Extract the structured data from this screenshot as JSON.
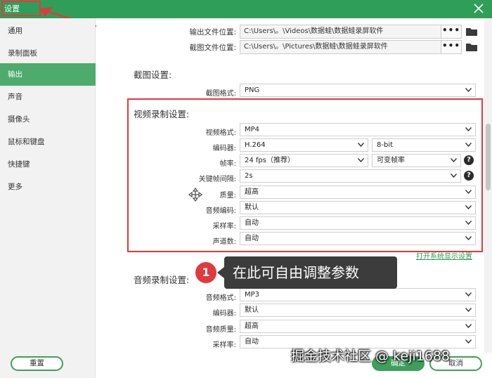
{
  "window": {
    "title": "设置"
  },
  "sidebar": {
    "items": [
      {
        "label": "通用"
      },
      {
        "label": "录制面板"
      },
      {
        "label": "输出"
      },
      {
        "label": "声音"
      },
      {
        "label": "摄像头"
      },
      {
        "label": "鼠标和键盘"
      },
      {
        "label": "快捷键"
      },
      {
        "label": "更多"
      }
    ],
    "active": "输出",
    "reset_label": "重置"
  },
  "output_paths": {
    "output_label": "输出文件位置:",
    "output_value": "C:\\Users\\。\\Videos\\数据蛙\\数据蛙录屏软件",
    "screenshot_label": "截图文件位置:",
    "screenshot_value": "C:\\Users\\。\\Pictures\\数据蛙\\数据蛙录屏软件",
    "browse_label": "•••"
  },
  "screenshot_settings": {
    "title": "截图设置:",
    "format_label": "截图格式:",
    "format_value": "PNG"
  },
  "video_settings": {
    "title": "视频录制设置:",
    "rows": {
      "format": {
        "label": "视频格式:",
        "value": "MP4"
      },
      "encoder": {
        "label": "编码器:",
        "value": "H.264",
        "bitdepth": "8-bit"
      },
      "framerate": {
        "label": "帧率:",
        "value": "24 fps（推荐）",
        "mode": "可变帧率"
      },
      "keyframe": {
        "label": "关键帧间隔:",
        "value": "2s"
      },
      "quality": {
        "label": "质量:",
        "value": "超高"
      },
      "audio_codec": {
        "label": "音频编码:",
        "value": "默认"
      },
      "sample_rate": {
        "label": "采样率:",
        "value": "自动"
      },
      "channels": {
        "label": "声道数:",
        "value": "自动"
      }
    },
    "link": "打开系统显示设置"
  },
  "audio_settings": {
    "title": "音频录制设置:",
    "rows": {
      "format": {
        "label": "音频格式:",
        "value": "MP3"
      },
      "encoder": {
        "label": "编码器:",
        "value": "默认"
      },
      "quality": {
        "label": "音频质量:",
        "value": "超高"
      },
      "sample_rate": {
        "label": "采样率:",
        "value": "自动"
      }
    }
  },
  "annotation": {
    "number": "1",
    "text": "在此可自由调整参数"
  },
  "buttons": {
    "ok": "确定",
    "cancel": "取消"
  },
  "help_glyph": "?",
  "watermark": "掘金技术社区 @ keji1688",
  "colors": {
    "accent": "#2f9e59",
    "highlight": "#e0393e"
  }
}
